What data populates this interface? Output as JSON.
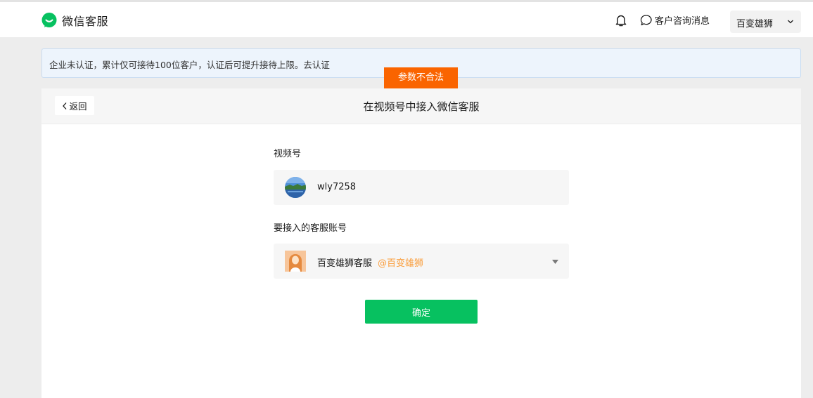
{
  "header": {
    "brand_name": "微信客服",
    "consult_label": "客户咨询消息",
    "account_name": "百变雄狮",
    "brand_color": "#07c160"
  },
  "notice": {
    "text": "企业未认证，累计仅可接待100位客户，认证后可提升接待上限。",
    "link_label": "去认证"
  },
  "toast": {
    "text": "参数不合法",
    "color": "#fa6400"
  },
  "panel": {
    "back_label": "返回",
    "title": "在视频号中接入微信客服"
  },
  "form": {
    "channel_label": "视频号",
    "channel_value": "wly7258",
    "service_label": "要接入的客服账号",
    "service_value": "百变雄狮客服",
    "service_sub": "@百变雄狮",
    "confirm_label": "确定",
    "confirm_color": "#07c160"
  }
}
